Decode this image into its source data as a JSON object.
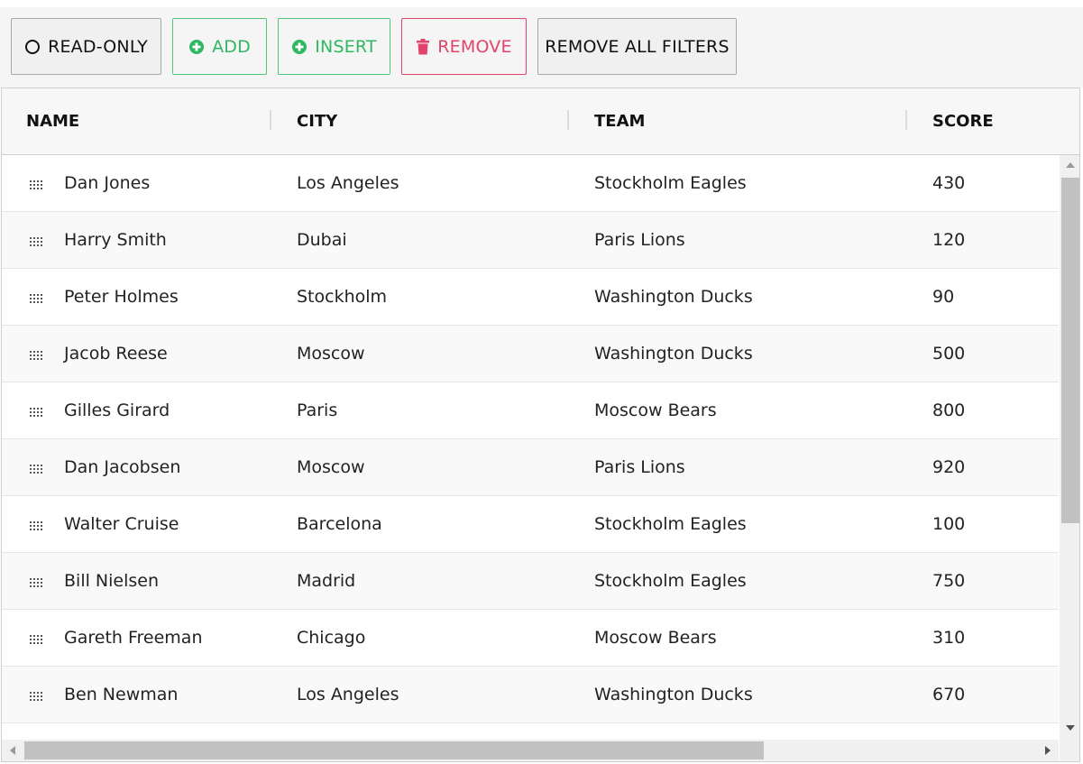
{
  "toolbar": {
    "read_only_label": "READ-ONLY",
    "add_label": "ADD",
    "insert_label": "INSERT",
    "remove_label": "REMOVE",
    "remove_all_filters_label": "REMOVE ALL FILTERS"
  },
  "colors": {
    "add": "#2fb861",
    "remove": "#e0446b"
  },
  "grid": {
    "columns": [
      "NAME",
      "CITY",
      "TEAM",
      "SCORE"
    ],
    "rows": [
      {
        "name": "Dan Jones",
        "city": "Los Angeles",
        "team": "Stockholm Eagles",
        "score": "430"
      },
      {
        "name": "Harry Smith",
        "city": "Dubai",
        "team": "Paris Lions",
        "score": "120"
      },
      {
        "name": "Peter Holmes",
        "city": "Stockholm",
        "team": "Washington Ducks",
        "score": "90"
      },
      {
        "name": "Jacob Reese",
        "city": "Moscow",
        "team": "Washington Ducks",
        "score": "500"
      },
      {
        "name": "Gilles Girard",
        "city": "Paris",
        "team": "Moscow Bears",
        "score": "800"
      },
      {
        "name": "Dan Jacobsen",
        "city": "Moscow",
        "team": "Paris Lions",
        "score": "920"
      },
      {
        "name": "Walter Cruise",
        "city": "Barcelona",
        "team": "Stockholm Eagles",
        "score": "100"
      },
      {
        "name": "Bill Nielsen",
        "city": "Madrid",
        "team": "Stockholm Eagles",
        "score": "750"
      },
      {
        "name": "Gareth Freeman",
        "city": "Chicago",
        "team": "Moscow Bears",
        "score": "310"
      },
      {
        "name": "Ben Newman",
        "city": "Los Angeles",
        "team": "Washington Ducks",
        "score": "670"
      }
    ]
  }
}
